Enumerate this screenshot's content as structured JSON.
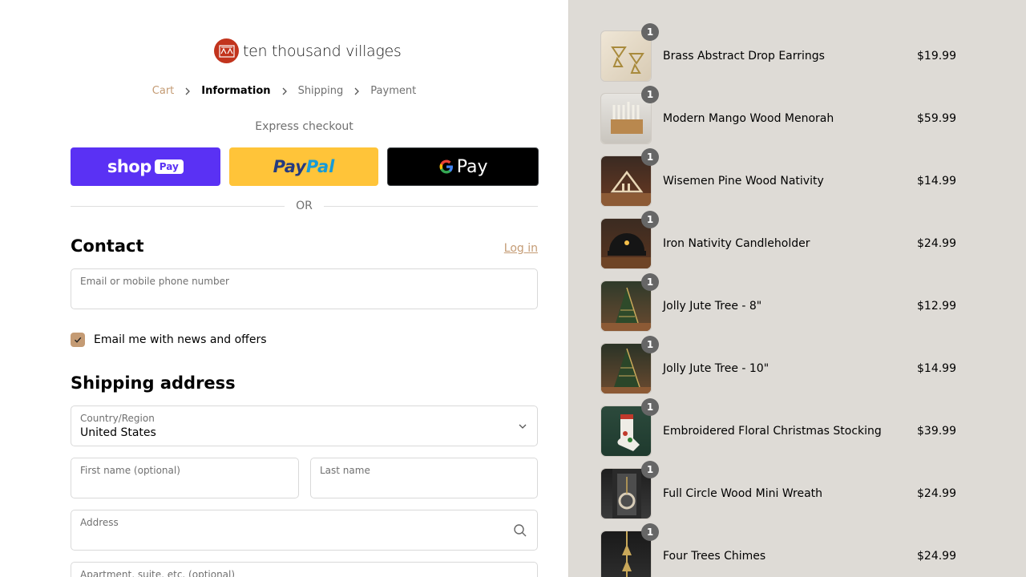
{
  "brand": {
    "name": "ten thousand villages"
  },
  "breadcrumb": [
    {
      "label": "Cart"
    },
    {
      "label": "Information"
    },
    {
      "label": "Shipping"
    },
    {
      "label": "Payment"
    }
  ],
  "express": {
    "title": "Express checkout",
    "shop_label": "shop",
    "shop_pay_label": "Pay",
    "paypal_label_1": "Pay",
    "paypal_label_2": "Pal",
    "gpay_label": "Pay",
    "or_label": "OR"
  },
  "contact": {
    "title": "Contact",
    "login_label": "Log in",
    "email_placeholder": "Email or mobile phone number",
    "newsletter_label": "Email me with news and offers",
    "newsletter_checked": true
  },
  "shipping": {
    "title": "Shipping address",
    "country_label": "Country/Region",
    "country_value": "United States",
    "first_name_label": "First name (optional)",
    "last_name_label": "Last name",
    "address_label": "Address",
    "apartment_label": "Apartment, suite, etc. (optional)"
  },
  "colors": {
    "accent": "#c49b74",
    "shop_pay": "#5a31f4",
    "paypal": "#ffc439",
    "sidebar_bg": "#dedbd6"
  },
  "cart": {
    "items": [
      {
        "name": "Brass Abstract Drop Earrings",
        "price": "$19.99",
        "qty": "1"
      },
      {
        "name": "Modern Mango Wood Menorah",
        "price": "$59.99",
        "qty": "1"
      },
      {
        "name": "Wisemen Pine Wood Nativity",
        "price": "$14.99",
        "qty": "1"
      },
      {
        "name": "Iron Nativity Candleholder",
        "price": "$24.99",
        "qty": "1"
      },
      {
        "name": "Jolly Jute Tree - 8\"",
        "price": "$12.99",
        "qty": "1"
      },
      {
        "name": "Jolly Jute Tree - 10\"",
        "price": "$14.99",
        "qty": "1"
      },
      {
        "name": "Embroidered Floral Christmas Stocking",
        "price": "$39.99",
        "qty": "1"
      },
      {
        "name": "Full Circle Wood Mini Wreath",
        "price": "$24.99",
        "qty": "1"
      },
      {
        "name": "Four Trees Chimes",
        "price": "$24.99",
        "qty": "1"
      }
    ]
  }
}
